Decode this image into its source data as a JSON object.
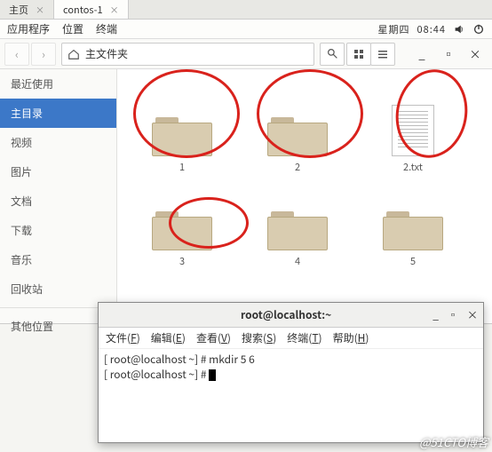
{
  "tabs": [
    {
      "label": "主页",
      "active": false
    },
    {
      "label": "contos-1",
      "active": true
    }
  ],
  "menubar": {
    "apps": "应用程序",
    "places": "位置",
    "terminal": "终端",
    "day": "星期四",
    "time": "08:44"
  },
  "toolbar": {
    "path_label": "主文件夹"
  },
  "sidebar": {
    "items": [
      {
        "label": "最近使用",
        "sel": false
      },
      {
        "label": "主目录",
        "sel": true
      },
      {
        "label": "视频",
        "sel": false
      },
      {
        "label": "图片",
        "sel": false
      },
      {
        "label": "文档",
        "sel": false
      },
      {
        "label": "下载",
        "sel": false
      },
      {
        "label": "音乐",
        "sel": false
      },
      {
        "label": "回收站",
        "sel": false
      }
    ],
    "other": "其他位置"
  },
  "files": [
    {
      "name": "1",
      "type": "folder"
    },
    {
      "name": "2",
      "type": "folder"
    },
    {
      "name": "2.txt",
      "type": "file"
    },
    {
      "name": "3",
      "type": "folder"
    },
    {
      "name": "4",
      "type": "folder"
    },
    {
      "name": "5",
      "type": "folder"
    }
  ],
  "terminal": {
    "title": "root@localhost:~",
    "menu": {
      "file": {
        "txt": "文件(",
        "k": "F",
        "e": ")"
      },
      "edit": {
        "txt": "编辑(",
        "k": "E",
        "e": ")"
      },
      "view": {
        "txt": "查看(",
        "k": "V",
        "e": ")"
      },
      "search": {
        "txt": "搜索(",
        "k": "S",
        "e": ")"
      },
      "term": {
        "txt": "终端(",
        "k": "T",
        "e": ")"
      },
      "help": {
        "txt": "帮助(",
        "k": "H",
        "e": ")"
      }
    },
    "line1": "[ root@localhost ~] # mkdir 5 6",
    "line2": "[ root@localhost ~] # "
  },
  "watermark": "@51CTO博客"
}
